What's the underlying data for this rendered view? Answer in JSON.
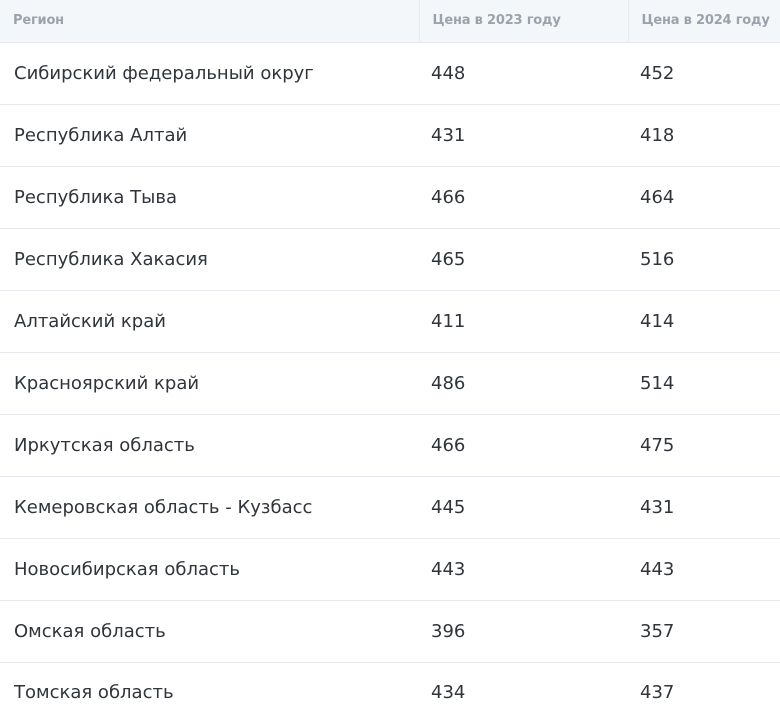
{
  "table": {
    "headers": [
      "Регион",
      "Цена в 2023 году",
      "Цена в 2024 году"
    ],
    "rows": [
      [
        "Сибирский федеральный округ",
        "448",
        "452"
      ],
      [
        "Республика Алтай",
        "431",
        "418"
      ],
      [
        "Республика Тыва",
        "466",
        "464"
      ],
      [
        "Республика Хакасия",
        "465",
        "516"
      ],
      [
        "Алтайский край",
        "411",
        "414"
      ],
      [
        "Красноярский край",
        "486",
        "514"
      ],
      [
        "Иркутская область",
        "466",
        "475"
      ],
      [
        "Кемеровская область - Кузбасс",
        "445",
        "431"
      ],
      [
        "Новосибирская область",
        "443",
        "443"
      ],
      [
        "Омская область",
        "396",
        "357"
      ],
      [
        "Томская область",
        "434",
        "437"
      ]
    ]
  },
  "colors": {
    "header_bg": "#f4f7fa",
    "header_text": "#9aa3ad",
    "cell_text": "#30343b",
    "row_border": "#e6eaee"
  }
}
